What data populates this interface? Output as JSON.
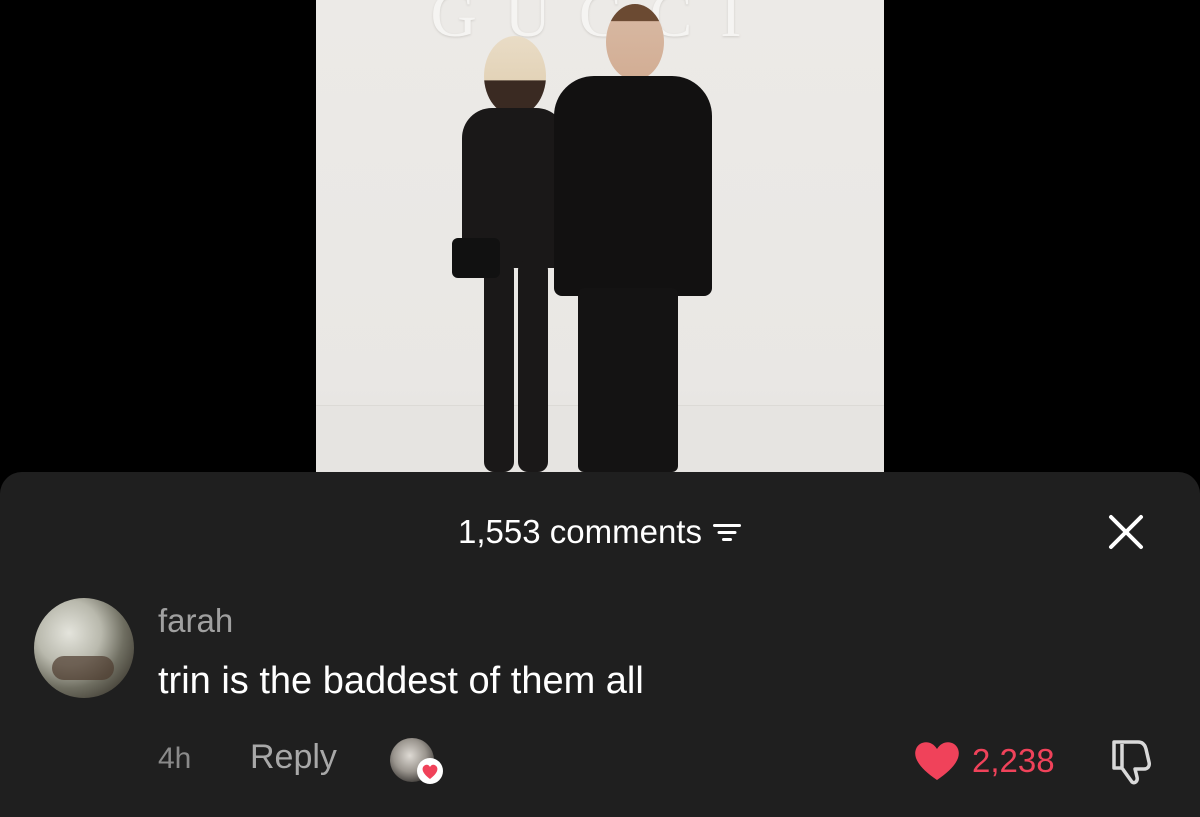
{
  "video": {
    "backdrop_logo": "GUCCI"
  },
  "comments_sheet": {
    "count_label": "1,553 comments",
    "comment": {
      "username": "farah",
      "text": "trin is the baddest of them all",
      "time": "4h",
      "reply_label": "Reply",
      "like_count": "2,238"
    }
  },
  "icons": {
    "filter": "filter-sort-icon",
    "close": "close-icon",
    "like": "heart-icon",
    "dislike": "thumbs-down-icon"
  },
  "colors": {
    "sheet_background": "#1f1f1f",
    "like_accent": "#f0425a",
    "muted_text": "#a0a0a0"
  }
}
